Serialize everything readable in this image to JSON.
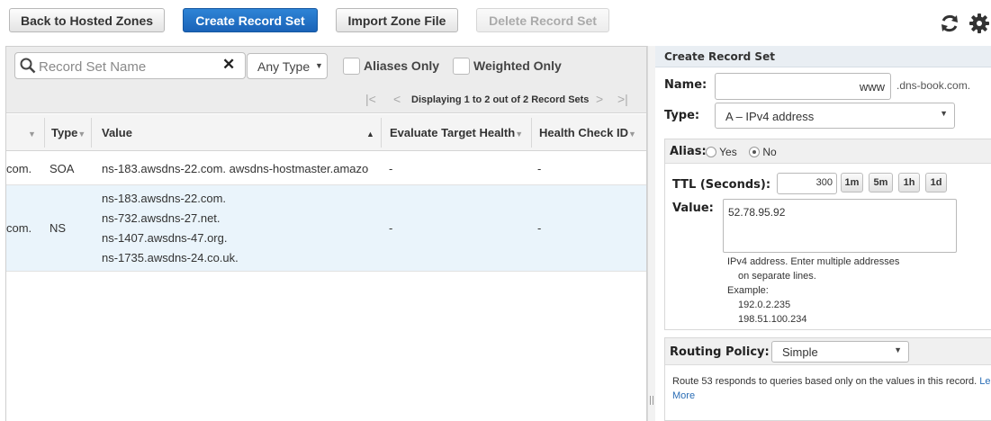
{
  "toolbar": {
    "back_label": "Back to Hosted Zones",
    "create_label": "Create Record Set",
    "import_label": "Import Zone File",
    "delete_label": "Delete Record Set",
    "refresh_icon": "refresh-icon",
    "settings_icon": "gear-icon"
  },
  "filter": {
    "search_placeholder": "Record Set Name",
    "clear_glyph": "✕",
    "type_select": "Any Type",
    "aliases_only": "Aliases Only",
    "weighted_only": "Weighted Only"
  },
  "pager": {
    "text": "Displaying 1 to 2 out of 2 Record Sets"
  },
  "table": {
    "headers": {
      "name": "",
      "type": "Type",
      "value": "Value",
      "evaluate": "Evaluate Target Health",
      "health": "Health Check ID"
    },
    "rows": [
      {
        "name": "com.",
        "type": "SOA",
        "values": [
          "ns-183.awsdns-22.com. awsdns-hostmaster.amazo"
        ],
        "evaluate": "-",
        "health": "-"
      },
      {
        "name": "com.",
        "type": "NS",
        "values": [
          "ns-183.awsdns-22.com.",
          "ns-732.awsdns-27.net.",
          "ns-1407.awsdns-47.org.",
          "ns-1735.awsdns-24.co.uk."
        ],
        "evaluate": "-",
        "health": "-"
      }
    ]
  },
  "form": {
    "title": "Create Record Set",
    "name_label": "Name:",
    "name_value": "www",
    "domain_suffix": ".dns-book.com.",
    "type_label": "Type:",
    "type_value": "A – IPv4 address",
    "alias_label": "Alias:",
    "alias_yes": "Yes",
    "alias_no": "No",
    "alias_selected": "No",
    "ttl_label": "TTL (Seconds):",
    "ttl_value": "300",
    "ttl_buttons": [
      "1m",
      "5m",
      "1h",
      "1d"
    ],
    "value_label": "Value:",
    "value_text": "52.78.95.92",
    "help_line1": "IPv4 address. Enter multiple addresses",
    "help_line2": "on separate lines.",
    "help_example": "Example:",
    "help_ex1": "192.0.2.235",
    "help_ex2": "198.51.100.234",
    "routing_label": "Routing Policy:",
    "routing_value": "Simple",
    "routing_help": "Route 53 responds to queries based only on the values in this record.",
    "learn_more_1": "Le",
    "learn_more_2": "More"
  },
  "colors": {
    "primary": "#1f6fc5",
    "selected_row": "#eaf4fb",
    "link": "#2a6db5"
  }
}
